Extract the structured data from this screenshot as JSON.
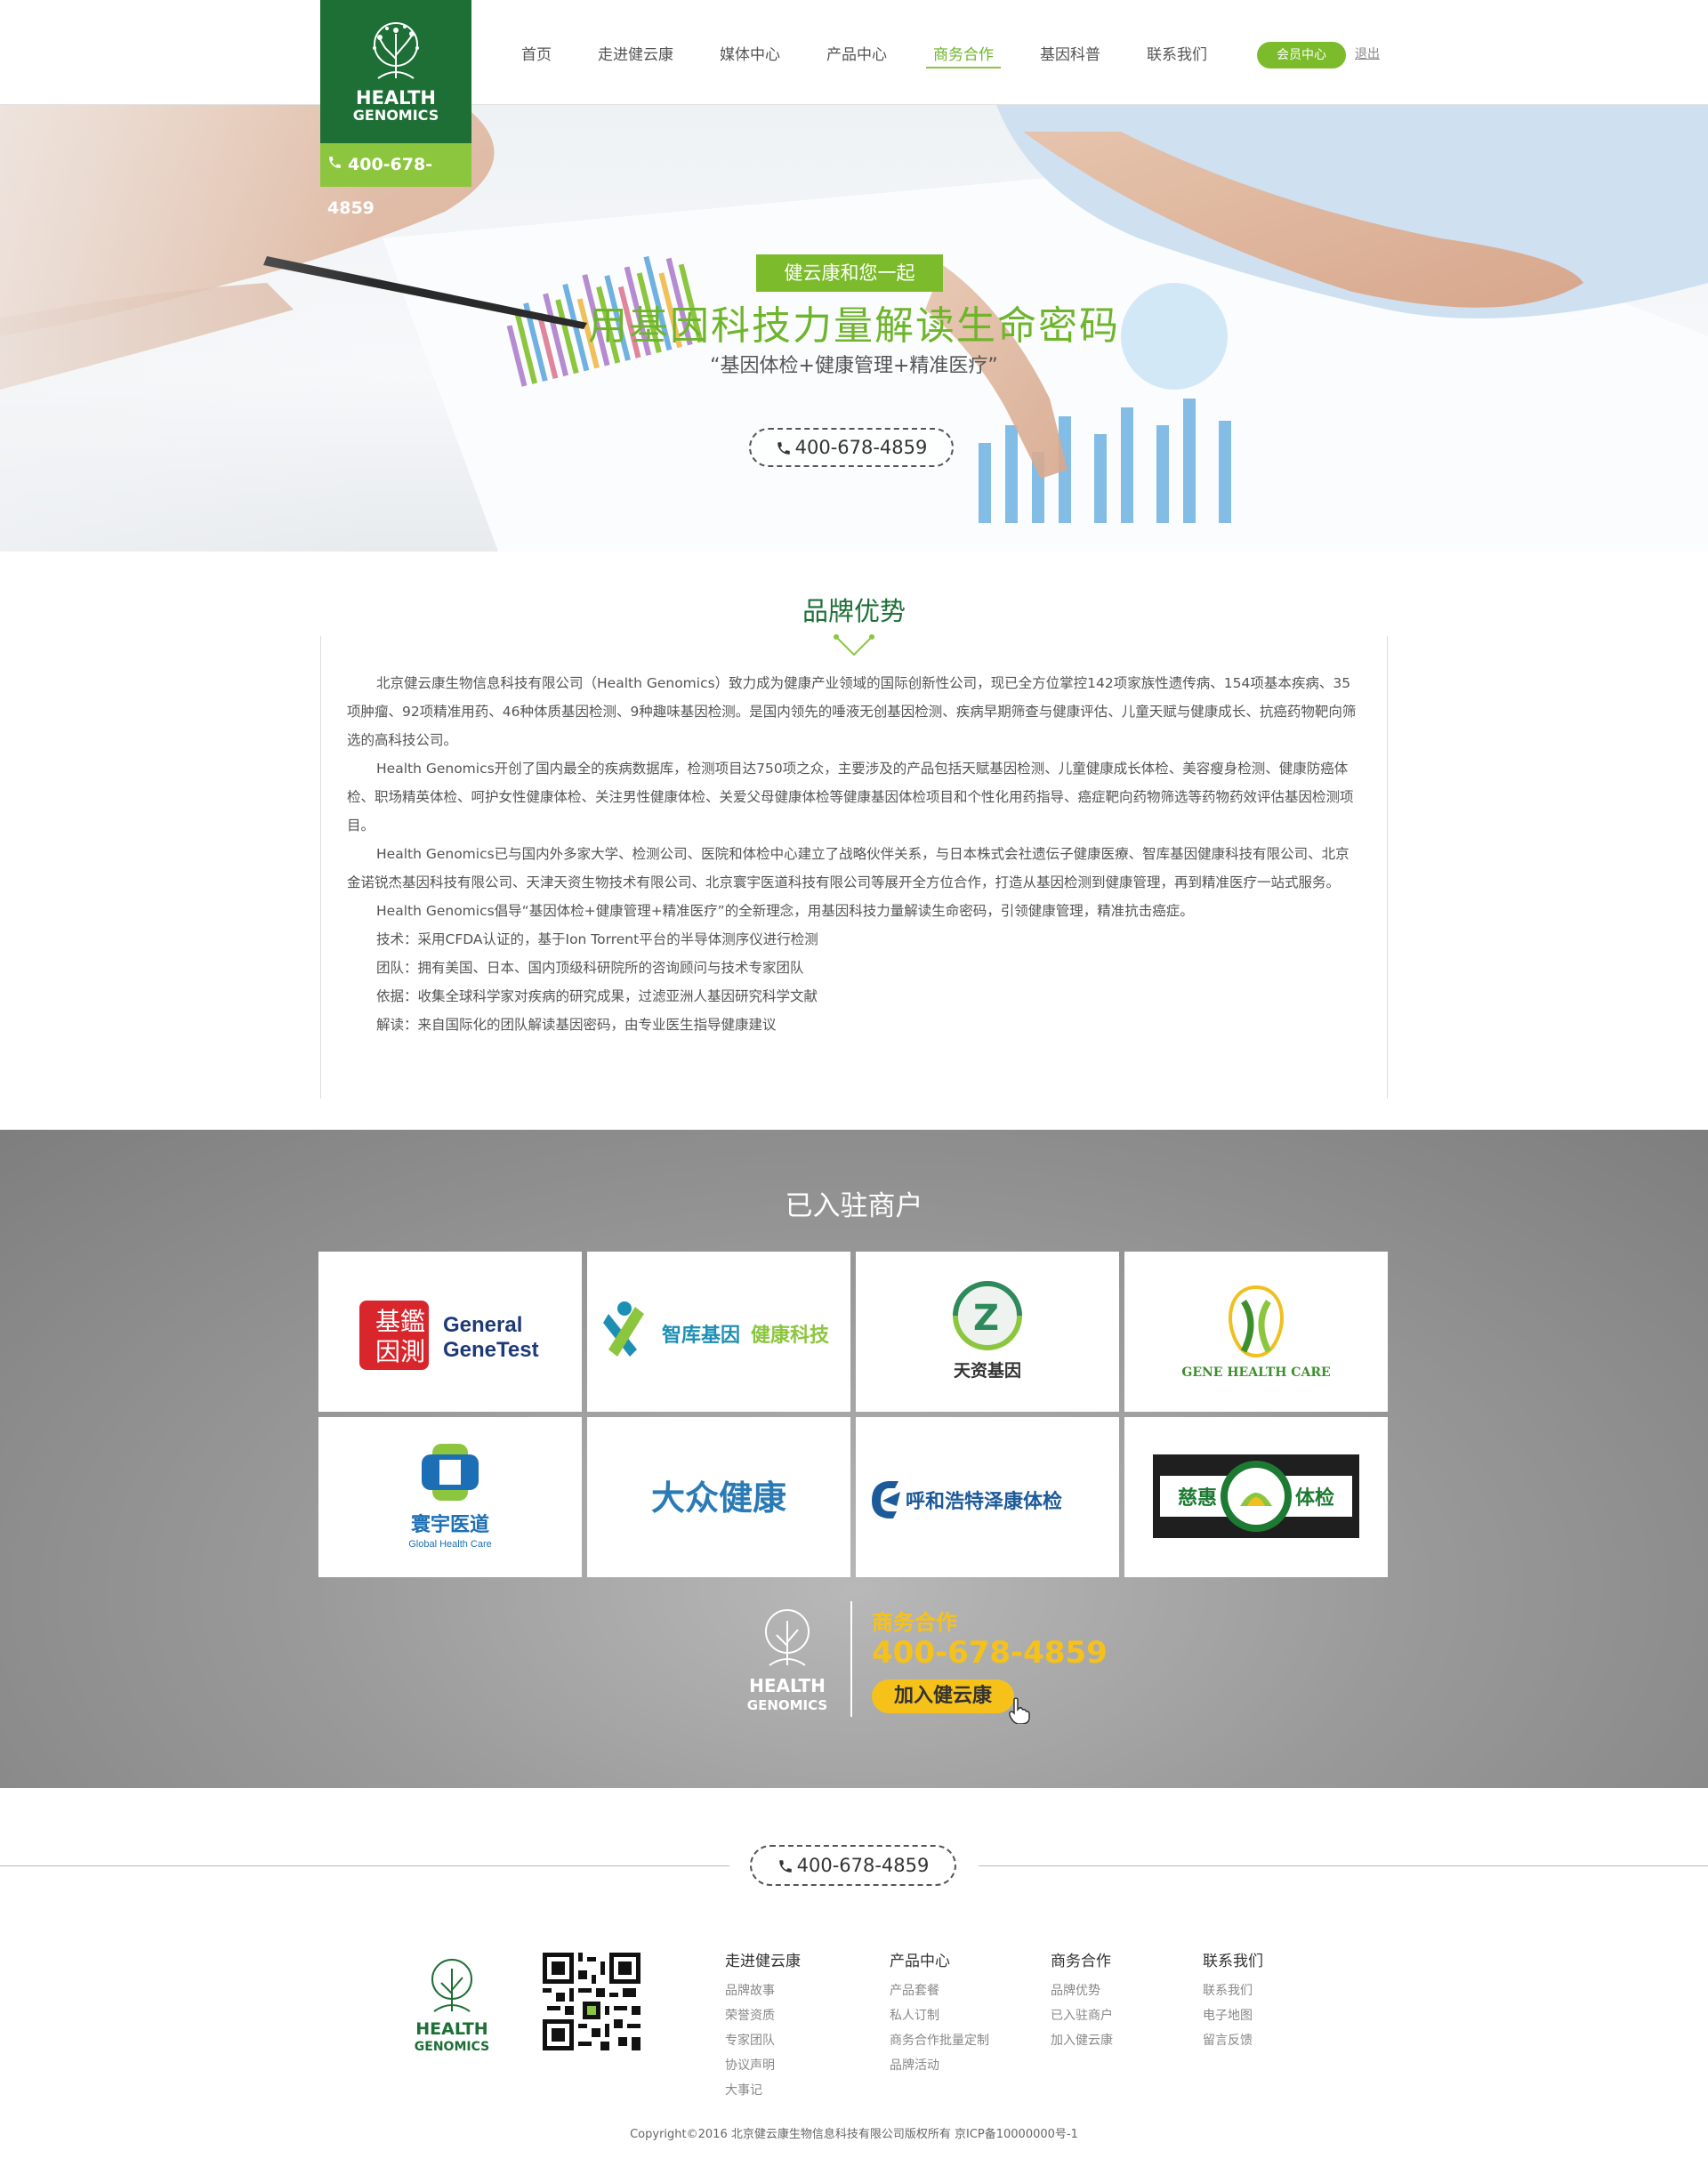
{
  "header": {
    "logo_line1": "HEALTH",
    "logo_line2": "GENOMICS",
    "phone": "400-678-4859",
    "nav": [
      {
        "label": "首页"
      },
      {
        "label": "走进健云康"
      },
      {
        "label": "媒体中心"
      },
      {
        "label": "产品中心"
      },
      {
        "label": "商务合作",
        "active": true
      },
      {
        "label": "基因科普"
      },
      {
        "label": "联系我们"
      }
    ],
    "member_center": "会员中心",
    "logout": "退出"
  },
  "hero": {
    "tag": "健云康和您一起",
    "title": "用基因科技力量解读生命密码",
    "subtitle": "“基因体检+健康管理+精准医疗”",
    "phone": "400-678-4859"
  },
  "brand": {
    "title": "品牌优势",
    "paragraphs": [
      "北京健云康生物信息科技有限公司（Health Genomics）致力成为健康产业领域的国际创新性公司，现已全方位掌控142项家族性遗传病、154项基本疾病、35项肿瘤、92项精准用药、46种体质基因检测、9种趣味基因检测。是国内领先的唾液无创基因检测、疾病早期筛查与健康评估、儿童天赋与健康成长、抗癌药物靶向筛选的高科技公司。",
      "Health Genomics开创了国内最全的疾病数据库，检测项目达750项之众，主要涉及的产品包括天赋基因检测、儿童健康成长体检、美容瘦身检测、健康防癌体检、职场精英体检、呵护女性健康体检、关注男性健康体检、关爱父母健康体检等健康基因体检项目和个性化用药指导、癌症靶向药物筛选等药物药效评估基因检测项目。",
      "Health Genomics已与国内外多家大学、检测公司、医院和体检中心建立了战略伙伴关系，与日本株式会社遗伝子健康医療、智库基因健康科技有限公司、北京金诺锐杰基因科技有限公司、天津天资生物技术有限公司、北京寰宇医道科技有限公司等展开全方位合作，打造从基因检测到健康管理，再到精准医疗一站式服务。",
      "Health Genomics倡导“基因体检+健康管理+精准医疗”的全新理念，用基因科技力量解读生命密码，引领健康管理，精准抗击癌症。",
      "技术：采用CFDA认证的，基于Ion Torrent平台的半导体测序仪进行检测",
      "团队：拥有美国、日本、国内顶级科研院所的咨询顾问与技术专家团队",
      "依据：收集全球科学家对疾病的研究成果，过滤亚洲人基因研究科学文献",
      "解读：来自国际化的团队解读基因密码，由专业医生指导健康建议"
    ]
  },
  "merchants": {
    "title": "已入驻商户",
    "logos": [
      {
        "name": "General GeneTest",
        "text1": "General",
        "text2": "GeneTest",
        "seal": "基因鑑測",
        "color": "#1f3a78"
      },
      {
        "name": "智库基因 健康科技",
        "text1": "智库基因",
        "text2": "健康科技",
        "color": "#1e8fb4"
      },
      {
        "name": "天资基因",
        "text1": "天资基因",
        "color": "#2e8a5a"
      },
      {
        "name": "GENE HEALTH CARE",
        "text1": "GENE HEALTH CARE",
        "color": "#3d8f2c"
      },
      {
        "name": "寰宇医道 Global Health Care",
        "text1": "寰宇医道",
        "text2": "Global Health Care",
        "color": "#1d6fb5"
      },
      {
        "name": "大众健康",
        "text1": "大众健康",
        "color": "#2a7bb5"
      },
      {
        "name": "呼和浩特泽康体检",
        "text1": "呼和浩特泽康体检",
        "color": "#1d5a9a"
      },
      {
        "name": "慈惠体检",
        "text1": "慈惠",
        "text2": "体检",
        "color": "#1d7a32"
      }
    ],
    "cooperation": {
      "label": "商务合作",
      "phone": "400-678-4859",
      "join": "加入健云康"
    }
  },
  "footer": {
    "phone": "400-678-4859",
    "columns": [
      {
        "title": "走进健云康",
        "items": [
          "品牌故事",
          "荣誉资质",
          "专家团队",
          "协议声明",
          "大事记"
        ]
      },
      {
        "title": "产品中心",
        "items": [
          "产品套餐",
          "私人订制",
          "商务合作批量定制",
          "品牌活动"
        ]
      },
      {
        "title": "商务合作",
        "items": [
          "品牌优势",
          "已入驻商户",
          "加入健云康"
        ]
      },
      {
        "title": "联系我们",
        "items": [
          "联系我们",
          "电子地图",
          "留言反馈"
        ]
      }
    ],
    "copyright": "Copyright©2016 北京健云康生物信息科技有限公司版权所有  京ICP备10000000号-1"
  },
  "colors": {
    "brand_green": "#1d6f36",
    "accent_green": "#7cbb2b",
    "coop_yellow": "#f6c21a"
  }
}
